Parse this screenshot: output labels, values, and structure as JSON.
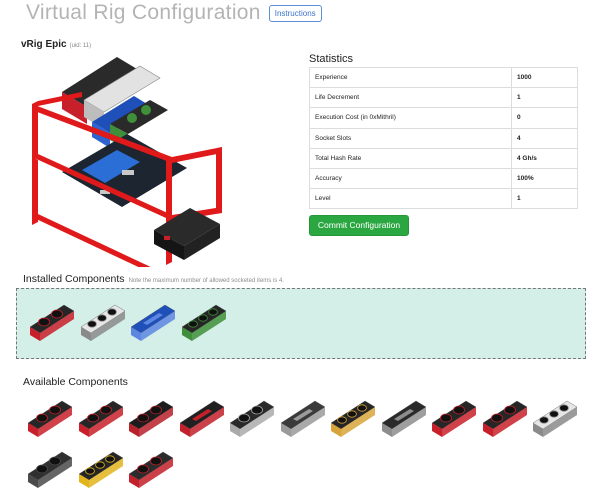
{
  "page": {
    "title": "Virtual Rig Configuration",
    "instructions_label": "Instructions"
  },
  "rig": {
    "name": "vRig Epic",
    "uid": "(uid: 11)"
  },
  "statistics": {
    "title": "Statistics",
    "rows": [
      {
        "label": "Experience",
        "value": "1000"
      },
      {
        "label": "Life Decrement",
        "value": "1"
      },
      {
        "label": "Execution Cost (in 0xMithril)",
        "value": "0"
      },
      {
        "label": "Socket Slots",
        "value": "4"
      },
      {
        "label": "Total Hash Rate",
        "value": "4 Gh/s"
      },
      {
        "label": "Accuracy",
        "value": "100%"
      },
      {
        "label": "Level",
        "value": "1"
      }
    ]
  },
  "commit_label": "Commit Configuration",
  "installed": {
    "title": "Installed Components",
    "note": "Note the maximum number of allowed socketed items is 4.",
    "cards": [
      {
        "icon": "gpu-card-icon",
        "body": "#262626",
        "accent": "#c8202a",
        "style": "fans2"
      },
      {
        "icon": "gpu-card-icon",
        "body": "#e6e6e6",
        "accent": "#8a8a8a",
        "style": "fans3"
      },
      {
        "icon": "gpu-card-icon",
        "body": "#1f4fb8",
        "accent": "#5c86e0",
        "style": "blower"
      },
      {
        "icon": "gpu-card-icon",
        "body": "#262626",
        "accent": "#3f8f3a",
        "style": "fans3"
      }
    ]
  },
  "available": {
    "title": "Available Components",
    "cards": [
      {
        "icon": "gpu-card-icon",
        "body": "#262626",
        "accent": "#c8202a",
        "style": "fans2"
      },
      {
        "icon": "gpu-card-icon",
        "body": "#262626",
        "accent": "#c8202a",
        "style": "fans2"
      },
      {
        "icon": "gpu-card-icon",
        "body": "#1c1c1c",
        "accent": "#b8202a",
        "style": "fans2"
      },
      {
        "icon": "gpu-card-icon",
        "body": "#202020",
        "accent": "#c2202a",
        "style": "blower"
      },
      {
        "icon": "gpu-card-icon",
        "body": "#2a2a2a",
        "accent": "#aaaaaa",
        "style": "fans2"
      },
      {
        "icon": "gpu-card-icon",
        "body": "#3a3a3a",
        "accent": "#9a9a9a",
        "style": "blower"
      },
      {
        "icon": "gpu-card-icon",
        "body": "#262626",
        "accent": "#d8a43a",
        "style": "fans3"
      },
      {
        "icon": "gpu-card-icon",
        "body": "#2a2a2a",
        "accent": "#8d8d8d",
        "style": "blower"
      },
      {
        "icon": "gpu-card-icon",
        "body": "#262626",
        "accent": "#c8202a",
        "style": "fans2"
      },
      {
        "icon": "gpu-card-icon",
        "body": "#262626",
        "accent": "#c8202a",
        "style": "fans2"
      },
      {
        "icon": "gpu-card-icon",
        "body": "#e6e6e6",
        "accent": "#8a8a8a",
        "style": "fans3"
      },
      {
        "icon": "gpu-card-icon",
        "body": "#303030",
        "accent": "#4a4a4a",
        "style": "fans2"
      },
      {
        "icon": "gpu-card-icon",
        "body": "#262626",
        "accent": "#e2b41c",
        "style": "fans3"
      },
      {
        "icon": "gpu-card-icon",
        "body": "#2c2c2c",
        "accent": "#c2202a",
        "style": "fans2"
      }
    ]
  },
  "colors": {
    "frame": "#e01a1a",
    "install_zone": "#d3efe8",
    "commit": "#2ba742",
    "link": "#3a73c9"
  }
}
